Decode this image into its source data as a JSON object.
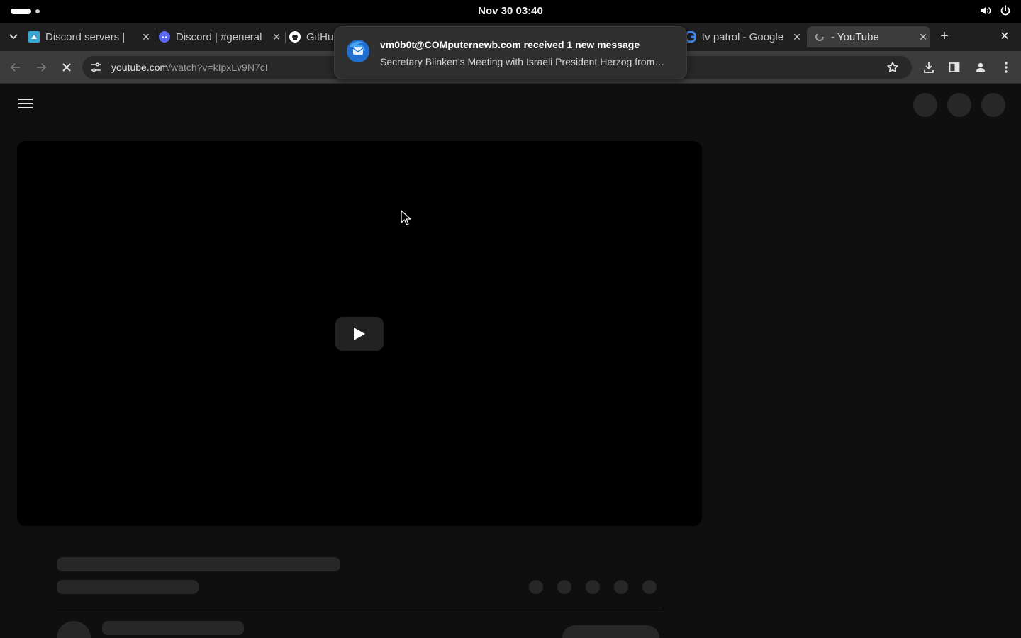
{
  "system": {
    "clock": "Nov 30  03:40",
    "icons": [
      "volume-icon",
      "power-icon"
    ]
  },
  "tabs": [
    {
      "title": "Discord servers | ",
      "favicon": "discord-servers-favicon"
    },
    {
      "title": "Discord | #general",
      "favicon": "discord-favicon"
    },
    {
      "title": "GitHub",
      "favicon": "github-favicon"
    },
    {
      "title": "tv patrol - Google",
      "favicon": "google-favicon"
    },
    {
      "title": " - YouTube",
      "favicon": "loading-favicon",
      "active": true
    }
  ],
  "toolbar": {
    "url_host": "youtube.com",
    "url_path": "/watch?v=kIpxLv9N7cI"
  },
  "notification": {
    "title": "vm0b0t@COMputernewb.com received 1 new message",
    "body": "Secretary Blinken’s Meeting with Israeli President Herzog from…",
    "app_icon": "thunderbird-icon"
  },
  "colors": {
    "page_bg": "#0f0f0f",
    "skeleton": "#272727",
    "toolbar": "#3c3c3c",
    "tabstrip": "#1f1f1f"
  }
}
